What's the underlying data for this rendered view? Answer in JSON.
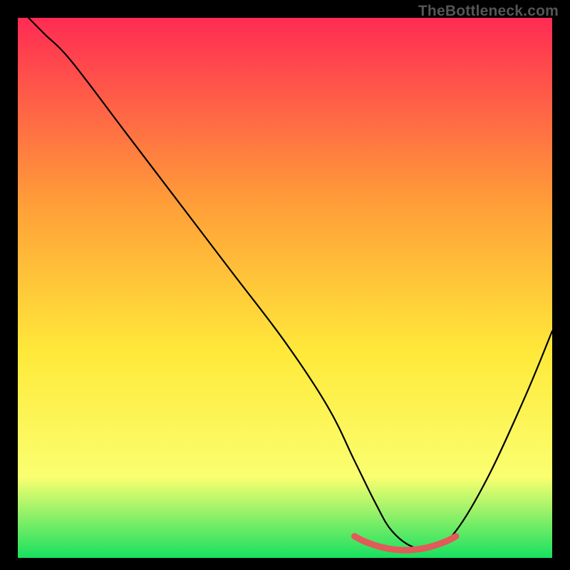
{
  "watermark": "TheBottleneck.com",
  "chart_data": {
    "type": "line",
    "title": "",
    "xlabel": "",
    "ylabel": "",
    "xlim": [
      0,
      100
    ],
    "ylim": [
      0,
      100
    ],
    "grid": false,
    "legend": false,
    "gradient": {
      "top": "#ff2b53",
      "mid_upper": "#ffa038",
      "mid": "#ffe93a",
      "mid_lower": "#faff70",
      "bottom": "#17e060"
    },
    "series": [
      {
        "name": "bottleneck-curve",
        "color": "#000000",
        "x": [
          2,
          5,
          10,
          20,
          30,
          40,
          50,
          58,
          63,
          67,
          70,
          74,
          78,
          82,
          88,
          95,
          100
        ],
        "y": [
          100,
          97,
          92,
          79,
          66,
          53,
          40,
          28,
          18,
          10,
          5,
          2,
          2,
          5,
          15,
          30,
          42
        ]
      },
      {
        "name": "optimal-range-highlight",
        "color": "#e25a5a",
        "x": [
          63,
          65,
          68,
          71,
          74,
          77,
          80,
          82
        ],
        "y": [
          4,
          3,
          2,
          1.5,
          1.5,
          2,
          3,
          4
        ]
      }
    ],
    "annotations": []
  }
}
